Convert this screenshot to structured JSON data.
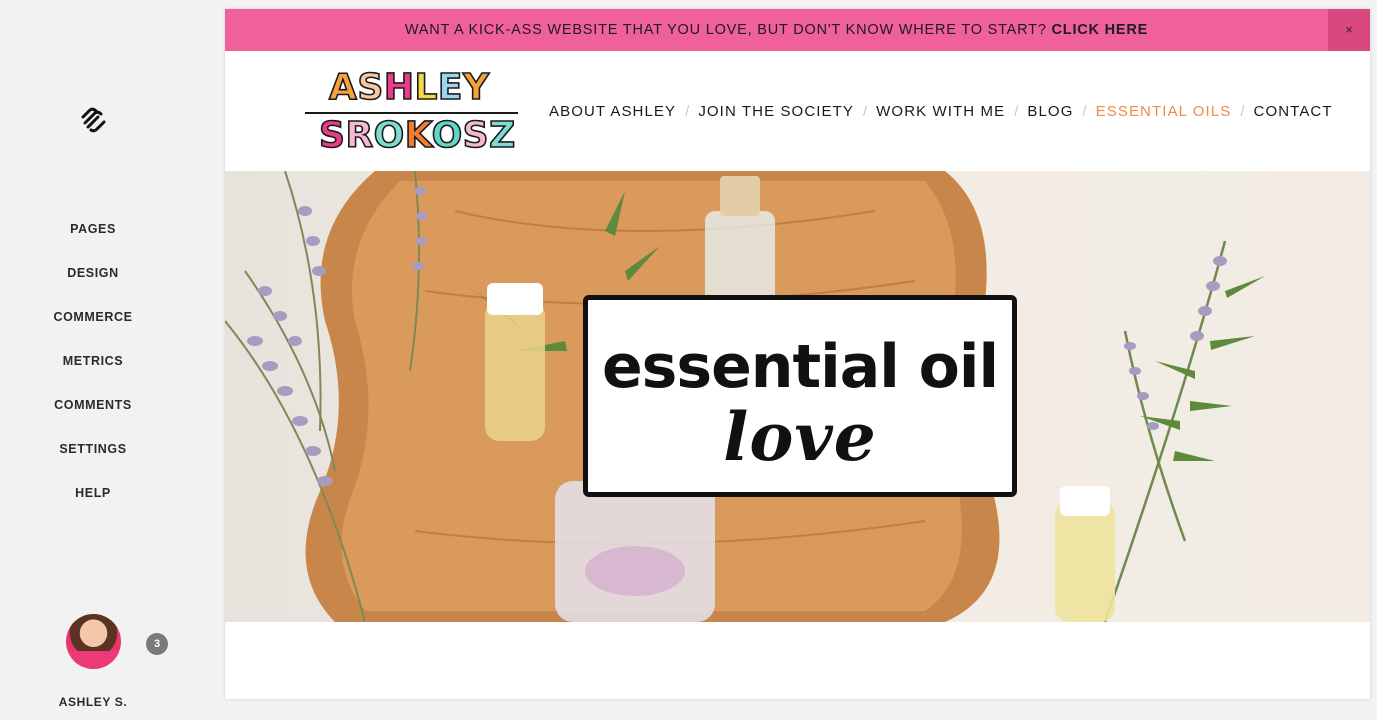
{
  "sidebar": {
    "items": [
      {
        "label": "PAGES"
      },
      {
        "label": "DESIGN"
      },
      {
        "label": "COMMERCE"
      },
      {
        "label": "METRICS"
      },
      {
        "label": "COMMENTS"
      },
      {
        "label": "SETTINGS"
      },
      {
        "label": "HELP"
      }
    ],
    "notification_count": "3",
    "user_name": "ASHLEY S."
  },
  "announcement": {
    "text": "WANT A KICK-ASS WEBSITE THAT YOU LOVE, BUT DON'T KNOW WHERE TO START? ",
    "cta": "CLICK HERE",
    "close_label": "×",
    "background": "#f0609a"
  },
  "brand": {
    "line1": [
      "A",
      "S",
      "H",
      "L",
      "E",
      "Y"
    ],
    "line2": [
      "S",
      "R",
      "O",
      "K",
      "O",
      "S",
      "Z"
    ],
    "line1_colors": [
      "#f4a23c",
      "#f7c7a2",
      "#ec3b8b",
      "#f5d84a",
      "#9ad6f0",
      "#f4a23c"
    ],
    "line2_colors": [
      "#ec3b8b",
      "#f7b7d2",
      "#7edbd1",
      "#f47c2f",
      "#5fd6c8",
      "#f7b7d2",
      "#7edbd1"
    ]
  },
  "nav": {
    "items": [
      {
        "label": "ABOUT ASHLEY",
        "active": false
      },
      {
        "label": "JOIN THE SOCIETY",
        "active": false
      },
      {
        "label": "WORK WITH ME",
        "active": false
      },
      {
        "label": "BLOG",
        "active": false
      },
      {
        "label": "ESSENTIAL OILS",
        "active": true
      },
      {
        "label": "CONTACT",
        "active": false
      }
    ],
    "separator": "/",
    "active_color": "#f08a4b"
  },
  "hero": {
    "line1": "essential oil",
    "line2": "love"
  }
}
